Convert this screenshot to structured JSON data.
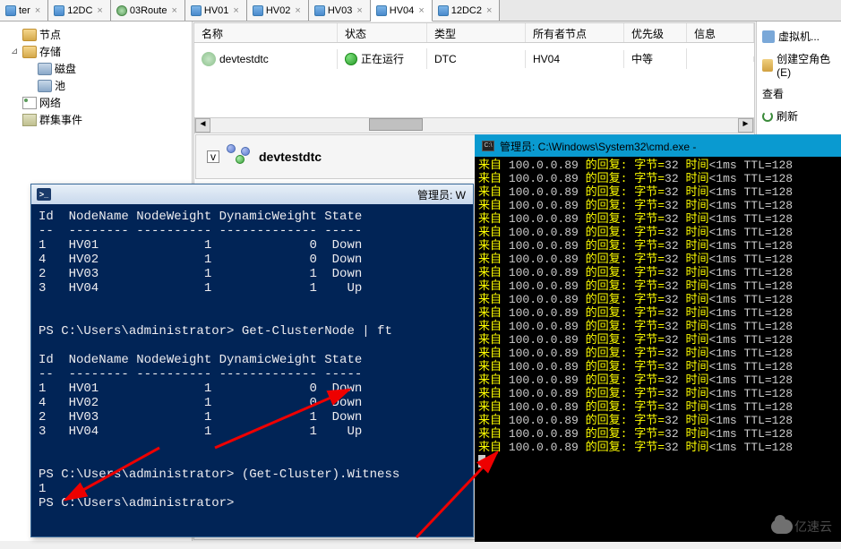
{
  "tabs": [
    {
      "label": "ter",
      "type": "server"
    },
    {
      "label": "12DC",
      "type": "server"
    },
    {
      "label": "03Route",
      "type": "group"
    },
    {
      "label": "HV01",
      "type": "server"
    },
    {
      "label": "HV02",
      "type": "server"
    },
    {
      "label": "HV03",
      "type": "server"
    },
    {
      "label": "HV04",
      "type": "server",
      "active": true
    },
    {
      "label": "12DC2",
      "type": "server"
    }
  ],
  "tree": {
    "nodes": {
      "label": "节点"
    },
    "storage": {
      "label": "存储",
      "expander": "⊿"
    },
    "disk": {
      "label": "磁盘"
    },
    "pool": {
      "label": "池"
    },
    "network": {
      "label": "网络"
    },
    "events": {
      "label": "群集事件"
    }
  },
  "grid": {
    "headers": {
      "name": "名称",
      "status": "状态",
      "type": "类型",
      "owner": "所有者节点",
      "priority": "优先级",
      "info": "信息"
    },
    "row": {
      "name": "devtestdtc",
      "status": "正在运行",
      "type": "DTC",
      "owner": "HV04",
      "priority": "中等",
      "info": ""
    }
  },
  "detail": {
    "name": "devtestdtc"
  },
  "actions": {
    "truncated_top": "…",
    "vm": {
      "label": "虚拟机..."
    },
    "role": {
      "label": "创建空角色(E)"
    },
    "view": {
      "label": "查看"
    },
    "refresh": {
      "label": "刷新"
    }
  },
  "ps": {
    "title": "管理员: W",
    "headers": "Id  NodeName NodeWeight DynamicWeight State",
    "dashes": "--  -------- ---------- ------------- -----",
    "rows1": [
      "1   HV01              1             0  Down",
      "4   HV02              1             0  Down",
      "2   HV03              1             1  Down",
      "3   HV04              1             1    Up"
    ],
    "prompt1": "PS C:\\Users\\administrator> Get-ClusterNode | ft ",
    "rows2": [
      "1   HV01              1             0  Down",
      "4   HV02              1             0  Down",
      "2   HV03              1             1  Down",
      "3   HV04              1             1    Up"
    ],
    "prompt2": "PS C:\\Users\\administrator> (Get-Cluster).Witness",
    "result2": "1",
    "prompt3": "PS C:\\Users\\administrator> "
  },
  "cmd": {
    "title": "管理员: C:\\Windows\\System32\\cmd.exe -",
    "ping_lines": [
      {
        "ip": "100.0.0.89",
        "bytes": "32",
        "time": "<1ms",
        "ttl": "128"
      },
      {
        "ip": "100.0.0.89",
        "bytes": "32",
        "time": "<1ms",
        "ttl": "128"
      },
      {
        "ip": "100.0.0.89",
        "bytes": "32",
        "time": "<1ms",
        "ttl": "128"
      },
      {
        "ip": "100.0.0.89",
        "bytes": "32",
        "time": "<1ms",
        "ttl": "128"
      },
      {
        "ip": "100.0.0.89",
        "bytes": "32",
        "time": "<1ms",
        "ttl": "128"
      },
      {
        "ip": "100.0.0.89",
        "bytes": "32",
        "time": "<1ms",
        "ttl": "128"
      },
      {
        "ip": "100.0.0.89",
        "bytes": "32",
        "time": "<1ms",
        "ttl": "128"
      },
      {
        "ip": "100.0.0.89",
        "bytes": "32",
        "time": "<1ms",
        "ttl": "128"
      },
      {
        "ip": "100.0.0.89",
        "bytes": "32",
        "time": "<1ms",
        "ttl": "128"
      },
      {
        "ip": "100.0.0.89",
        "bytes": "32",
        "time": "<1ms",
        "ttl": "128"
      },
      {
        "ip": "100.0.0.89",
        "bytes": "32",
        "time": "<1ms",
        "ttl": "128"
      },
      {
        "ip": "100.0.0.89",
        "bytes": "32",
        "time": "<1ms",
        "ttl": "128"
      },
      {
        "ip": "100.0.0.89",
        "bytes": "32",
        "time": "<1ms",
        "ttl": "128"
      },
      {
        "ip": "100.0.0.89",
        "bytes": "32",
        "time": "<1ms",
        "ttl": "128"
      },
      {
        "ip": "100.0.0.89",
        "bytes": "32",
        "time": "<1ms",
        "ttl": "128"
      },
      {
        "ip": "100.0.0.89",
        "bytes": "32",
        "time": "<1ms",
        "ttl": "128"
      },
      {
        "ip": "100.0.0.89",
        "bytes": "32",
        "time": "<1ms",
        "ttl": "128"
      },
      {
        "ip": "100.0.0.89",
        "bytes": "32",
        "time": "<1ms",
        "ttl": "128"
      },
      {
        "ip": "100.0.0.89",
        "bytes": "32",
        "time": "<1ms",
        "ttl": "128"
      },
      {
        "ip": "100.0.0.89",
        "bytes": "32",
        "time": "<1ms",
        "ttl": "128"
      },
      {
        "ip": "100.0.0.89",
        "bytes": "32",
        "time": "<1ms",
        "ttl": "128"
      },
      {
        "ip": "100.0.0.89",
        "bytes": "32",
        "time": "<1ms",
        "ttl": "128"
      }
    ],
    "ping_template": {
      "prefix": "来自 ",
      "reply": " 的回复: ",
      "bytes_lbl": "字节=",
      "time_lbl": " 时间",
      "ttl_lbl": " TTL="
    }
  },
  "watermark": "亿速云"
}
